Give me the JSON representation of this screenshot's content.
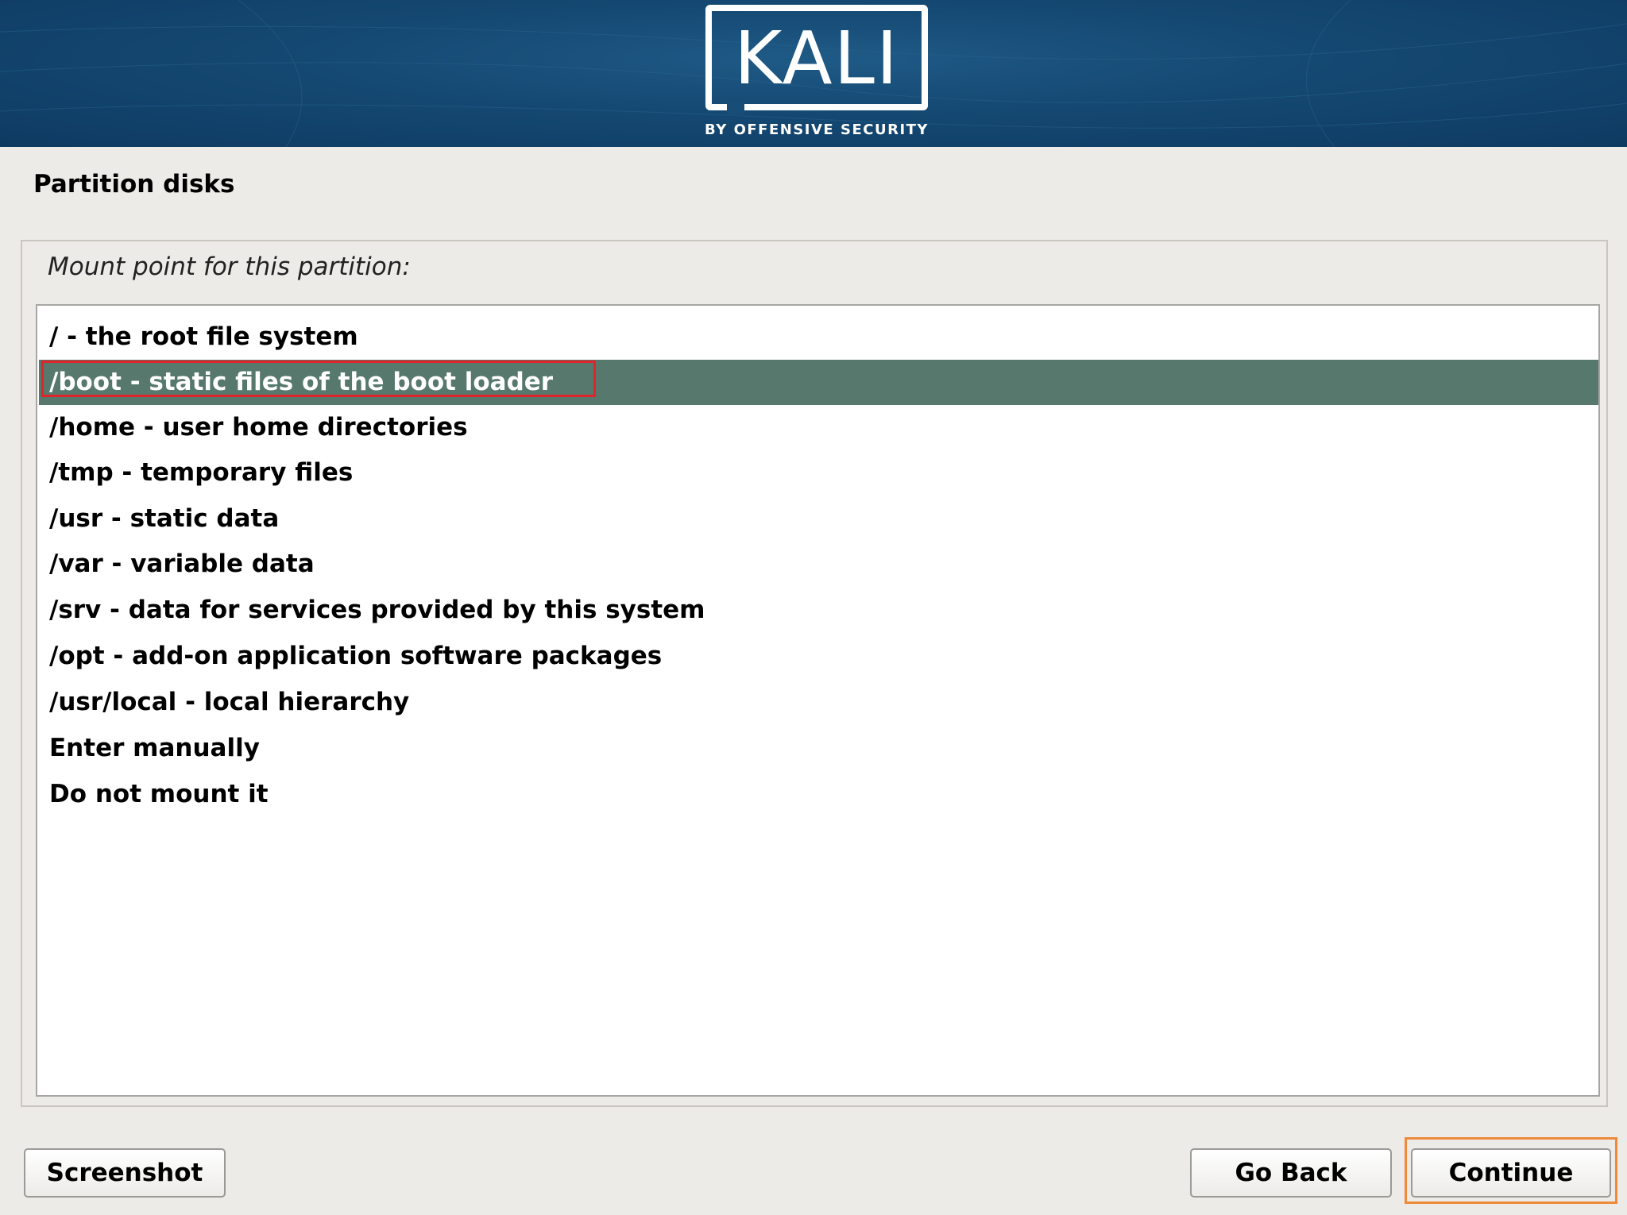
{
  "banner": {
    "logo_text": "KALI",
    "logo_subtitle": "BY OFFENSIVE SECURITY"
  },
  "page": {
    "title": "Partition disks"
  },
  "question": {
    "prompt": "Mount point for this partition:"
  },
  "mount_options": [
    {
      "label": "/ - the root file system",
      "selected": false
    },
    {
      "label": "/boot - static files of the boot loader",
      "selected": true
    },
    {
      "label": "/home - user home directories",
      "selected": false
    },
    {
      "label": "/tmp - temporary files",
      "selected": false
    },
    {
      "label": "/usr - static data",
      "selected": false
    },
    {
      "label": "/var - variable data",
      "selected": false
    },
    {
      "label": "/srv - data for services provided by this system",
      "selected": false
    },
    {
      "label": "/opt - add-on application software packages",
      "selected": false
    },
    {
      "label": "/usr/local - local hierarchy",
      "selected": false
    },
    {
      "label": "Enter manually",
      "selected": false
    },
    {
      "label": "Do not mount it",
      "selected": false
    }
  ],
  "buttons": {
    "screenshot": "Screenshot",
    "go_back": "Go Back",
    "continue": "Continue"
  },
  "colors": {
    "banner": "#154a74",
    "selection": "#56786d",
    "highlight_outline": "#e0242b",
    "focus_outline": "#ee8a3a"
  }
}
